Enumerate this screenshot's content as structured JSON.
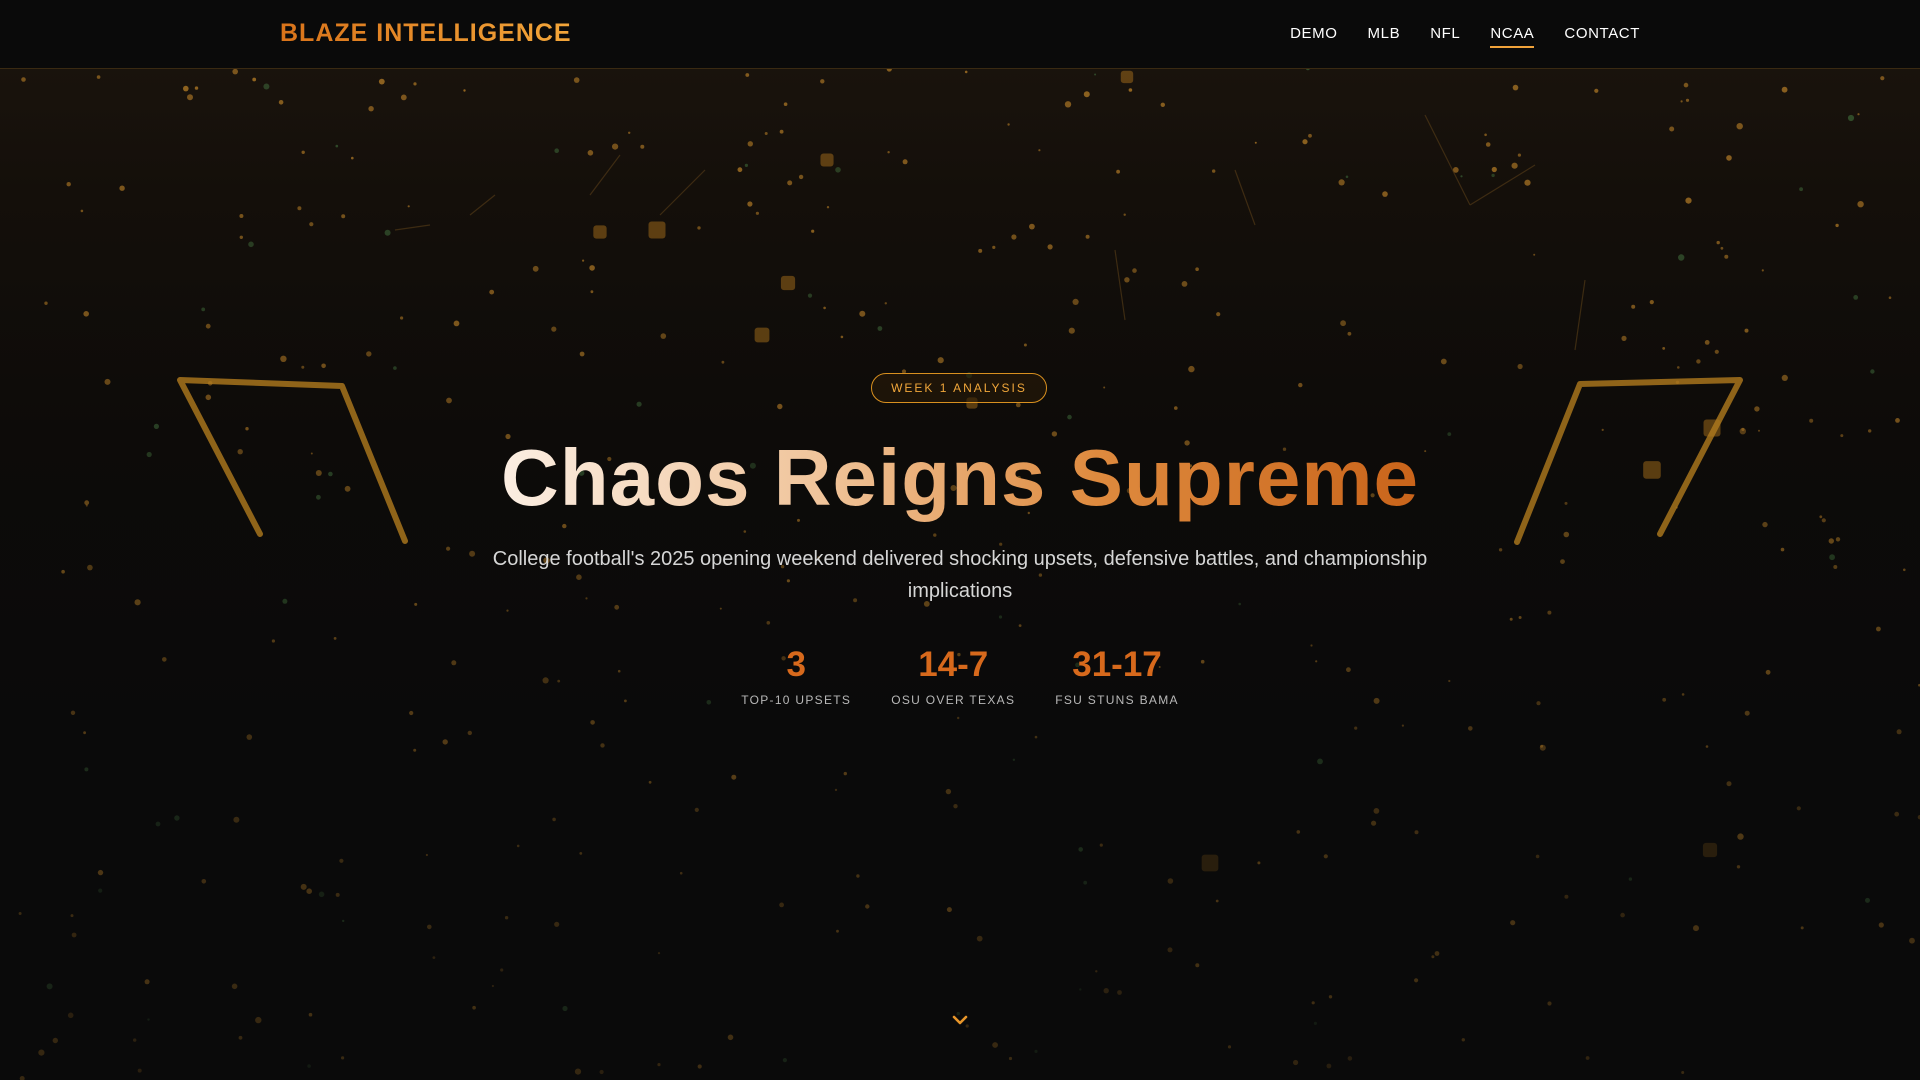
{
  "brand": {
    "name": "BLAZE INTELLIGENCE"
  },
  "nav": {
    "items": [
      {
        "label": "DEMO"
      },
      {
        "label": "MLB"
      },
      {
        "label": "NFL"
      },
      {
        "label": "NCAA",
        "active": true
      },
      {
        "label": "CONTACT"
      }
    ]
  },
  "hero": {
    "badge": "WEEK 1 ANALYSIS",
    "title": "Chaos Reigns Supreme",
    "subtitle": "College football's 2025 opening weekend delivered shocking upsets, defensive battles, and championship implications",
    "stats": [
      {
        "value": "3",
        "label": "TOP-10 UPSETS"
      },
      {
        "value": "14-7",
        "label": "OSU OVER TEXAS"
      },
      {
        "value": "31-17",
        "label": "FSU STUNS BAMA"
      }
    ],
    "scroll_icon": "chevron-down-icon"
  },
  "colors": {
    "accent": "#e08a22",
    "stat_value": "#d7691c",
    "background": "#0a0a0a",
    "badge_border": "#d8901f"
  }
}
